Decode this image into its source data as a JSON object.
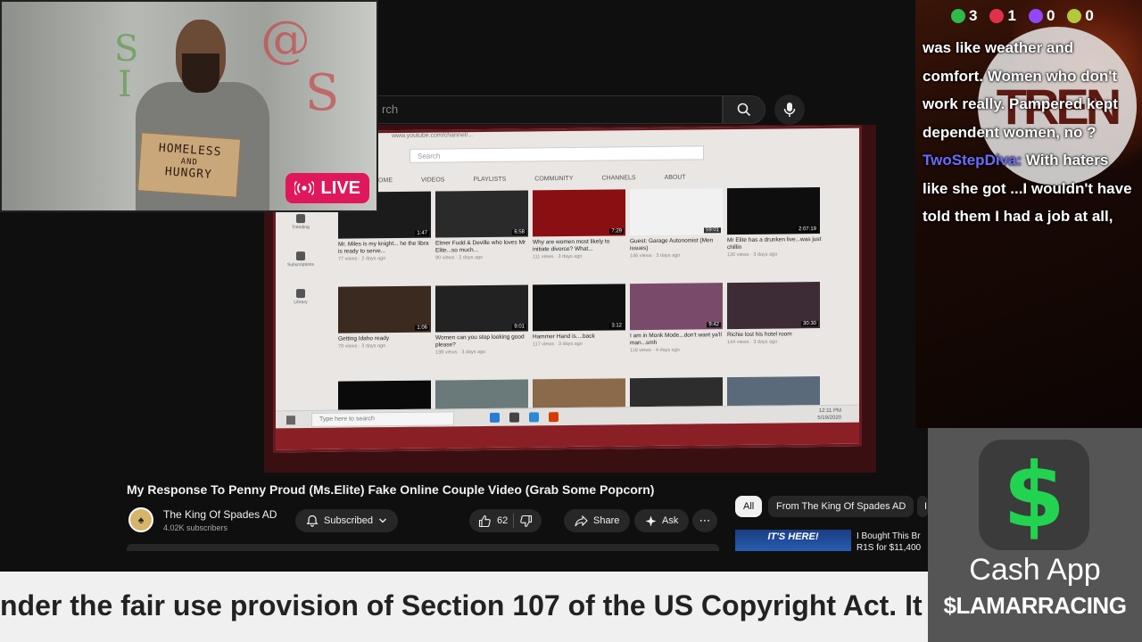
{
  "youtube": {
    "search_placeholder": "rch"
  },
  "screen_video": {
    "inner_search": "Search",
    "tabs": [
      "HOME",
      "VIDEOS",
      "PLAYLISTS",
      "COMMUNITY",
      "CHANNELS",
      "ABOUT"
    ],
    "sidebar": [
      "Trending",
      "Subscriptions",
      "Library"
    ],
    "cards": [
      {
        "title": "Mr. Miles is my knight... he the libra is ready to serve...",
        "meta": "77 views · 2 days ago",
        "duration": "1:47",
        "color": "#1b1b1b"
      },
      {
        "title": "Elmer Fudd & Deville who loves Mr Elite...so much...",
        "meta": "90 views · 2 days ago",
        "duration": "6:58",
        "color": "#2a2a2a"
      },
      {
        "title": "Why are women most likely to initiate divorce? What...",
        "meta": "111 views · 3 days ago",
        "duration": "7:29",
        "color": "#8a0f12"
      },
      {
        "title": "Guest: Garage Autonomist (Men issues)",
        "meta": "146 views · 3 days ago",
        "duration": "59:01",
        "color": "#f1f1f1"
      },
      {
        "title": "Mr Elite has a drunken live...was just chillin",
        "meta": "130 views · 3 days ago",
        "duration": "2:07:19",
        "color": "#0e0e0e"
      },
      {
        "title": "Getting Idaho ready",
        "meta": "79 views · 3 days ago",
        "duration": "1:06",
        "color": "#3b2a20"
      },
      {
        "title": "Women can you stop looking good please?",
        "meta": "138 views · 3 days ago",
        "duration": "9:01",
        "color": "#222"
      },
      {
        "title": "Hammer Hand is....back",
        "meta": "117 views · 3 days ago",
        "duration": "3:12",
        "color": "#101010"
      },
      {
        "title": "I am in Monk Mode...don't want ya'll man...smh",
        "meta": "118 views · 4 days ago",
        "duration": "9:42",
        "color": "#7a4a6a"
      },
      {
        "title": "Richie lost his hotel room",
        "meta": "144 views · 3 days ago",
        "duration": "30:30",
        "color": "#3d2b36"
      },
      {
        "title": "",
        "meta": "",
        "duration": "",
        "color": "#0a0a0a"
      },
      {
        "title": "",
        "meta": "",
        "duration": "",
        "color": "#6a7a7a"
      },
      {
        "title": "",
        "meta": "",
        "duration": "",
        "color": "#8a6a4a"
      },
      {
        "title": "",
        "meta": "",
        "duration": "",
        "color": "#2d2d2d"
      },
      {
        "title": "",
        "meta": "",
        "duration": "",
        "color": "#5a6a7a"
      }
    ],
    "url_tooltip": "https://www.youtube.com/watch?v=...",
    "taskbar_search": "Type here to search",
    "clock_time": "12:11 PM",
    "clock_date": "5/19/2020"
  },
  "live_cam": {
    "sign_line1": "HOMELESS",
    "sign_line2": "AND",
    "sign_line3": "HUNGRY",
    "badge": "LIVE"
  },
  "video_info": {
    "title": "My Response To Penny Proud (Ms.Elite) Fake Online Couple Video (Grab Some Popcorn)",
    "channel": "The King Of Spades AD",
    "subscribers": "4.02K subscribers",
    "subscribed_label": "Subscribed",
    "likes": "62",
    "share_label": "Share",
    "ask_label": "Ask"
  },
  "chips": {
    "all": "All",
    "from_channel": "From The King Of Spades AD",
    "partial": "I"
  },
  "recommended": {
    "thumb_text": "IT'S HERE!",
    "title": "I Bought This Br R1S for $11,400"
  },
  "ticker": {
    "text": "nder the fair use provision of Section 107 of the US Copyright Act. It"
  },
  "chat": {
    "stats": [
      {
        "icon": "play-icon",
        "value": "3",
        "color": "#2dbb4a"
      },
      {
        "icon": "youtube-icon",
        "value": "1",
        "color": "#e0304a"
      },
      {
        "icon": "twitch-icon",
        "value": "0",
        "color": "#9146ff"
      },
      {
        "icon": "link-icon",
        "value": "0",
        "color": "#b3c83a"
      }
    ],
    "logo_text": "TREN",
    "message1": "was like weather and comfort. Women who don't work really. Pampered kept dependent women, no ?",
    "user2": "TwoStepDiva:",
    "message2": "With haters like she got ...I wouldn't have told them I had a job at all,"
  },
  "cashapp": {
    "symbol": "$",
    "name": "Cash App",
    "tag": "$LAMARRACING"
  }
}
